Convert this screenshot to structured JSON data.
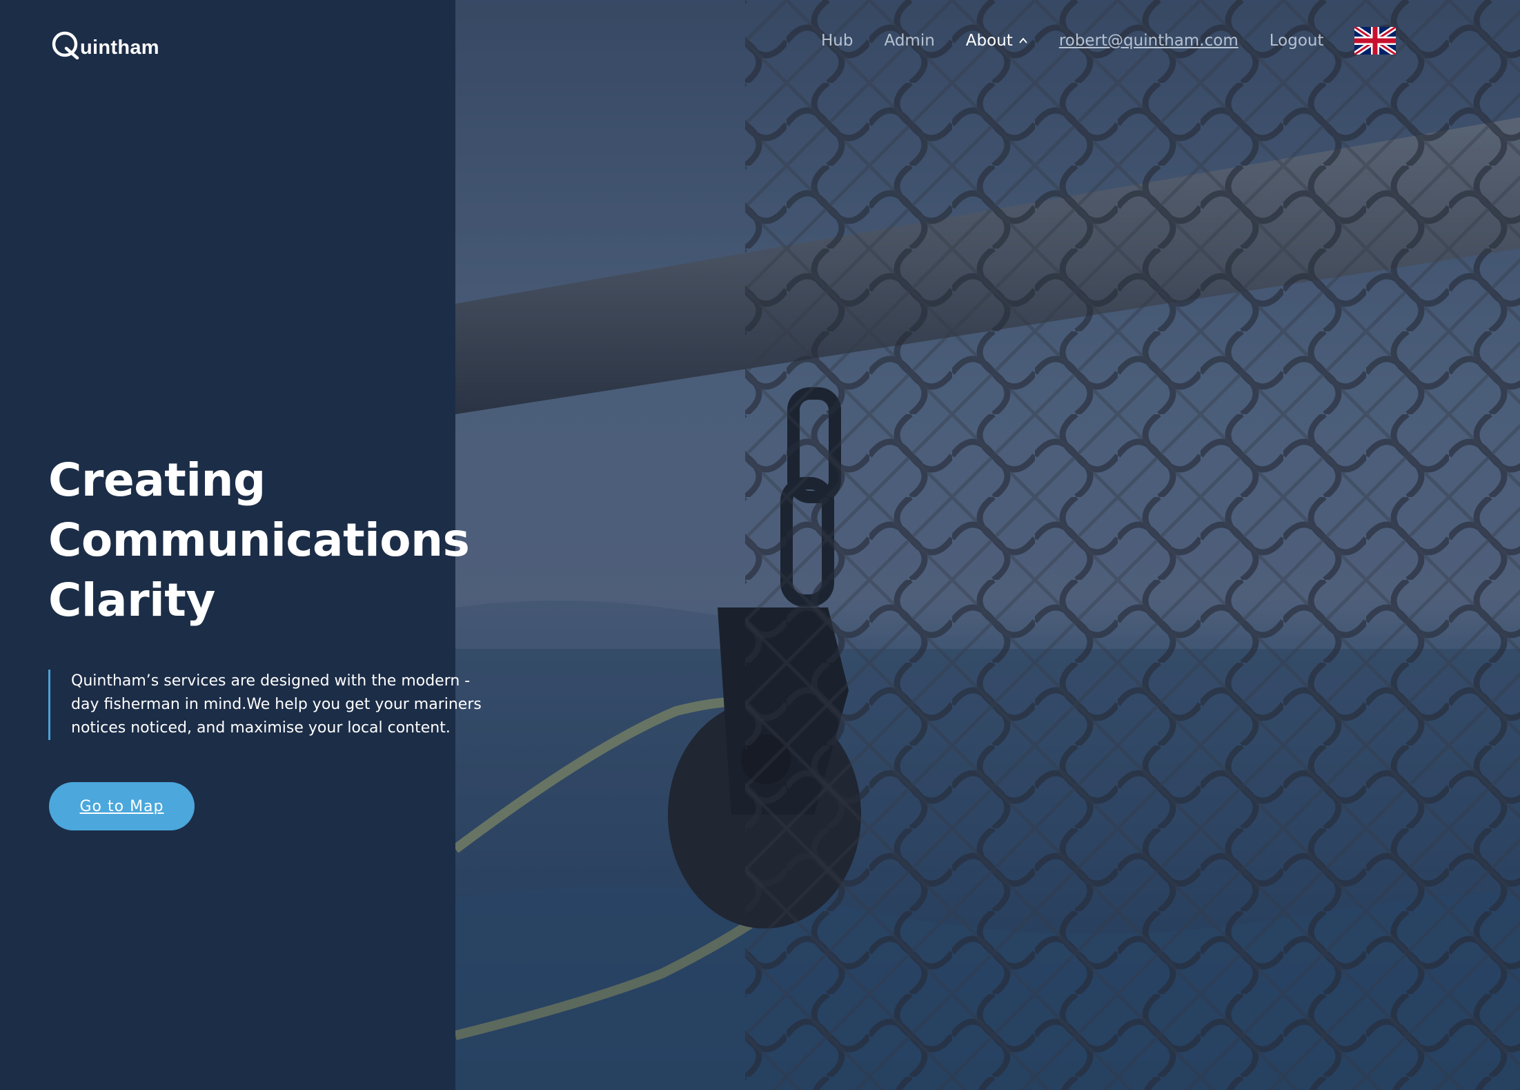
{
  "header": {
    "logo_text": "uintham",
    "logo_icon": "quintham-q-logo-icon"
  },
  "nav": {
    "items": [
      {
        "label": "Hub"
      },
      {
        "label": "Admin"
      },
      {
        "label": "About"
      },
      {
        "label": "robert@quintham.com"
      },
      {
        "label": "Logout"
      }
    ],
    "language_icon": "uk-flag-icon",
    "about_chevron_icon": "chevron-up-icon"
  },
  "hero": {
    "headline_lines": [
      "Creating",
      "Communications",
      "Clarity"
    ],
    "description_lines": [
      "Quintham’s services are designed with the modern -",
      "day fisherman in mind.We help you get your mariners",
      "notices noticed, and maximise your local content."
    ],
    "cta_label": "Go to Map"
  },
  "colors": {
    "panel": "#1c2d47",
    "accent": "#4ba7dc",
    "nav_text": "#b7c2d2"
  }
}
